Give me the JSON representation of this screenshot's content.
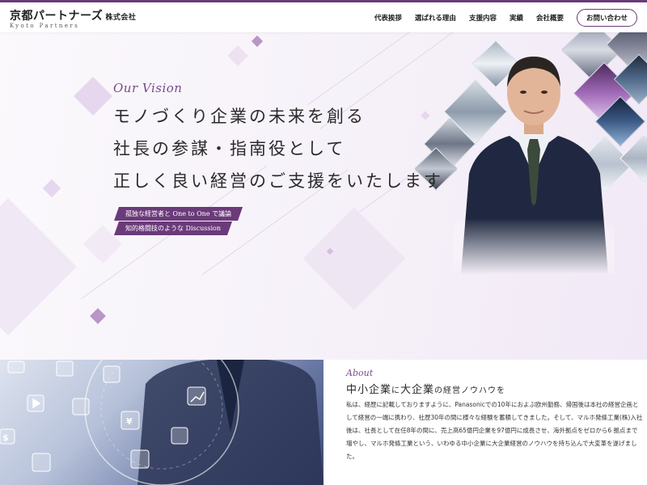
{
  "header": {
    "logo_main": "京都パートナーズ",
    "logo_sub": "株式会社",
    "logo_en": "Kyoto Partners",
    "nav": [
      {
        "label": "代表挨拶"
      },
      {
        "label": "選ばれる理由"
      },
      {
        "label": "支援内容"
      },
      {
        "label": "実績"
      },
      {
        "label": "会社概要"
      }
    ],
    "contact_label": "お問い合わせ"
  },
  "hero": {
    "vision_label": "Our Vision",
    "lines": [
      "モノづくり企業の未来を創る",
      "社長の参謀・指南役として",
      "正しく良い経営のご支援をいたします"
    ],
    "tags": [
      "孤独な経営者と One to One で議論",
      "知的格闘技のような Discussion"
    ],
    "colors": {
      "accent": "#6b3a7a",
      "accent_light": "#c9a8d6"
    }
  },
  "about": {
    "label": "About",
    "title_a": "中小企業",
    "title_b": "に",
    "title_c": "大企業",
    "title_d": "の経営ノウハウを",
    "body": "私は、経歴に記載しておりますように、Panasonicでの10年におよぶ欧州勤務、帰国後は本社の経営企画として経営の一端に携わり、社歴30年の間に様々な経験を蓄積してきました。そして、マルホ発條工業(株)入社後は、社長として在任8年の間に、売上高65億円企業を97億円に成長させ、海外拠点をゼロから6 拠点まで増やし、マルホ発條工業という、いわゆる中小企業に大企業経営のノウハウを持ち込んで大変革を遂げました。",
    "icons": [
      "camera-icon",
      "document-icon",
      "calendar-icon",
      "chart-icon",
      "play-icon",
      "user-icon",
      "yen-icon",
      "calculator-icon",
      "dollar-icon",
      "headset-icon",
      "gear-icon"
    ]
  }
}
